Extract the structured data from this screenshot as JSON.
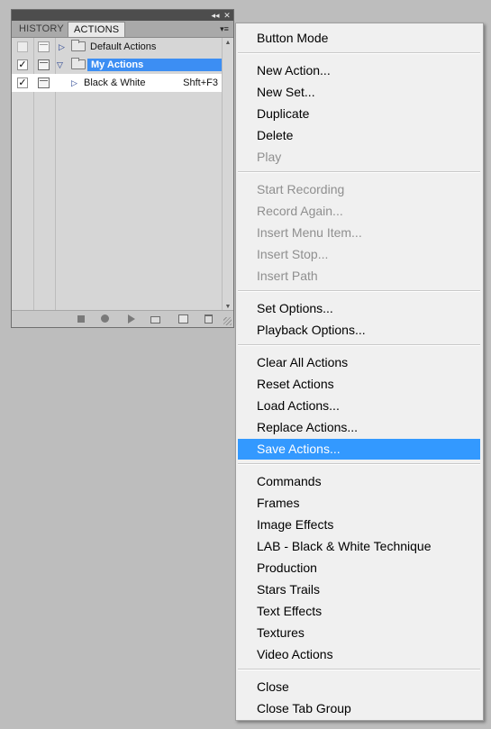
{
  "panel": {
    "collapse_glyph": "◂◂",
    "close_glyph": "✕",
    "menu_glyph": "▾≡",
    "tabs": [
      {
        "label": "HISTORY",
        "active": false
      },
      {
        "label": "ACTIONS",
        "active": true
      }
    ],
    "rows": [
      {
        "type": "set",
        "label": "Default Actions",
        "checked": false,
        "expanded": false,
        "selected": false
      },
      {
        "type": "set",
        "label": "My Actions",
        "checked": true,
        "expanded": true,
        "selected": true
      },
      {
        "type": "action",
        "label": "Black & White",
        "shortcut": "Shft+F3",
        "checked": true
      }
    ],
    "check_glyph": "✓",
    "collapsed_glyph": "▷",
    "expanded_glyph": "▽",
    "scroll_up_glyph": "▲",
    "scroll_down_glyph": "▼",
    "bottom_icons": [
      "stop-icon",
      "record-icon",
      "play-icon",
      "new-set-icon",
      "new-action-icon",
      "trash-icon"
    ]
  },
  "menu": {
    "highlight_color": "#3399ff",
    "groups": [
      [
        {
          "label": "Button Mode",
          "enabled": true
        }
      ],
      [
        {
          "label": "New Action...",
          "enabled": true
        },
        {
          "label": "New Set...",
          "enabled": true
        },
        {
          "label": "Duplicate",
          "enabled": true
        },
        {
          "label": "Delete",
          "enabled": true
        },
        {
          "label": "Play",
          "enabled": false
        }
      ],
      [
        {
          "label": "Start Recording",
          "enabled": false
        },
        {
          "label": "Record Again...",
          "enabled": false
        },
        {
          "label": "Insert Menu Item...",
          "enabled": false
        },
        {
          "label": "Insert Stop...",
          "enabled": false
        },
        {
          "label": "Insert Path",
          "enabled": false
        }
      ],
      [
        {
          "label": "Set Options...",
          "enabled": true
        },
        {
          "label": "Playback Options...",
          "enabled": true
        }
      ],
      [
        {
          "label": "Clear All Actions",
          "enabled": true
        },
        {
          "label": "Reset Actions",
          "enabled": true
        },
        {
          "label": "Load Actions...",
          "enabled": true
        },
        {
          "label": "Replace Actions...",
          "enabled": true
        },
        {
          "label": "Save Actions...",
          "enabled": true,
          "highlighted": true
        }
      ],
      [
        {
          "label": "Commands",
          "enabled": true
        },
        {
          "label": "Frames",
          "enabled": true
        },
        {
          "label": "Image Effects",
          "enabled": true
        },
        {
          "label": "LAB - Black & White Technique",
          "enabled": true
        },
        {
          "label": "Production",
          "enabled": true
        },
        {
          "label": "Stars Trails",
          "enabled": true
        },
        {
          "label": "Text Effects",
          "enabled": true
        },
        {
          "label": "Textures",
          "enabled": true
        },
        {
          "label": "Video Actions",
          "enabled": true
        }
      ],
      [
        {
          "label": "Close",
          "enabled": true
        },
        {
          "label": "Close Tab Group",
          "enabled": true
        }
      ]
    ]
  }
}
